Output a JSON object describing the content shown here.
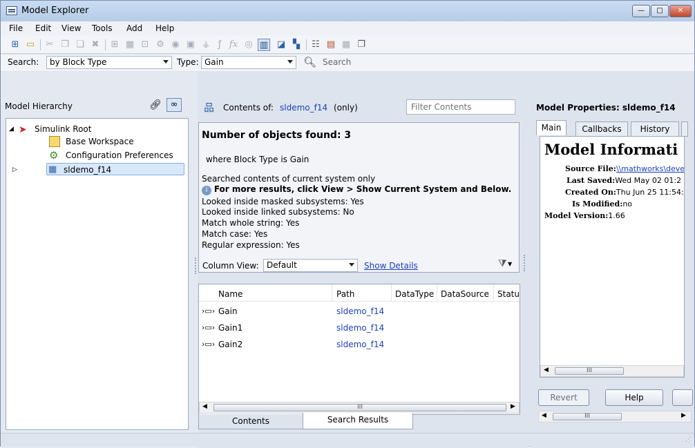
{
  "window": {
    "title": "Model Explorer",
    "controls": [
      "minimize",
      "maximize",
      "close"
    ]
  },
  "menu": [
    "File",
    "Edit",
    "View",
    "Tools",
    "Add",
    "Help"
  ],
  "toolbar_icons": [
    "new-model-icon",
    "open-folder-icon",
    "cut-icon",
    "copy-icon",
    "paste-icon",
    "delete-icon",
    "grid-icon",
    "matrix-icon",
    "add-data-icon",
    "signal-icon",
    "stateflow-icon",
    "frame-icon",
    "gain-icon",
    "fx-icon",
    "target-icon",
    "column-view-icon",
    "hierarchy-icon",
    "property-icon",
    "report-icon",
    "model-ref-icon",
    "map-icon",
    "copy-settings-icon"
  ],
  "search": {
    "search_label": "Search:",
    "search_by": "by Block Type",
    "type_label": "Type:",
    "type_value": "Gain",
    "search_button": "Search"
  },
  "hierarchy": {
    "title": "Model Hierarchy",
    "items": [
      {
        "label": "Simulink Root",
        "icon": "simulink-root-icon"
      },
      {
        "label": "Base Workspace",
        "icon": "workspace-icon"
      },
      {
        "label": "Configuration Preferences",
        "icon": "config-icon"
      },
      {
        "label": "sldemo_f14",
        "icon": "model-icon"
      }
    ]
  },
  "contents": {
    "label": "Contents of:",
    "model_link": "sldemo_f14",
    "scope": "(only)",
    "filter_placeholder": "Filter Contents",
    "results_title": "Number of objects found: 3",
    "where_line": "where Block Type is Gain",
    "info_lines": [
      "Searched contents of current system only"
    ],
    "hint": "For more results, click View > Show Current System and Below.",
    "details": [
      "Looked inside masked subsystems: Yes",
      "Looked inside linked subsystems: No",
      "Match whole string: Yes",
      "Match case: Yes",
      "Regular expression: Yes"
    ],
    "column_view_label": "Column View:",
    "column_view_value": "Default",
    "show_details": "Show Details",
    "columns": [
      "Name",
      "Path",
      "DataType",
      "DataSource",
      "Statu"
    ],
    "rows": [
      {
        "name": "Gain",
        "path": "sldemo_f14"
      },
      {
        "name": "Gain1",
        "path": "sldemo_f14"
      },
      {
        "name": "Gain2",
        "path": "sldemo_f14"
      }
    ],
    "scroll_thumb": "III",
    "tabs": [
      "Contents",
      "Search Results"
    ]
  },
  "properties": {
    "title": "Model Properties: sldemo_f14",
    "tabs": [
      "Main",
      "Callbacks",
      "History"
    ],
    "heading": "Model Informati",
    "fields": [
      {
        "key": "Source File:",
        "value": "\\\\mathworks\\deve"
      },
      {
        "key": "Last Saved:",
        "value": "Wed May 02 01:2"
      },
      {
        "key": "Created On:",
        "value": "Thu Jun 25 11:54:"
      },
      {
        "key": "Is Modified:",
        "value": "no"
      },
      {
        "key": "Model Version:",
        "value": "1.66"
      }
    ],
    "revert": "Revert",
    "help": "Help",
    "scroll_thumb": "III"
  }
}
